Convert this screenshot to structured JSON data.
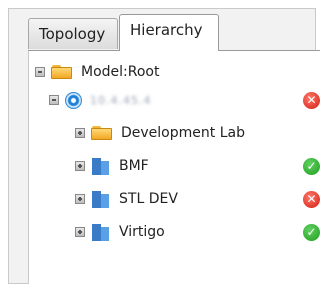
{
  "tabs": [
    {
      "label": "Topology",
      "active": false
    },
    {
      "label": "Hierarchy",
      "active": true
    }
  ],
  "tree": {
    "root": {
      "label": "Model:Root",
      "icon": "folder-icon",
      "expanded": true
    },
    "server": {
      "label": "10.4.45.4",
      "icon": "globe-icon",
      "expanded": true,
      "status": "error"
    },
    "children": [
      {
        "label": "Development Lab",
        "icon": "folder-icon",
        "status": null
      },
      {
        "label": "BMF",
        "icon": "building-icon",
        "status": "ok"
      },
      {
        "label": "STL DEV",
        "icon": "building-icon",
        "status": "error"
      },
      {
        "label": "Virtigo",
        "icon": "building-icon",
        "status": "ok"
      }
    ]
  },
  "colors": {
    "ok": "#1e9e1e",
    "error": "#d21c12",
    "folder": "#f2a823",
    "link": "#1e7fd8"
  },
  "status_glyphs": {
    "ok": "✓",
    "error": "✕"
  }
}
